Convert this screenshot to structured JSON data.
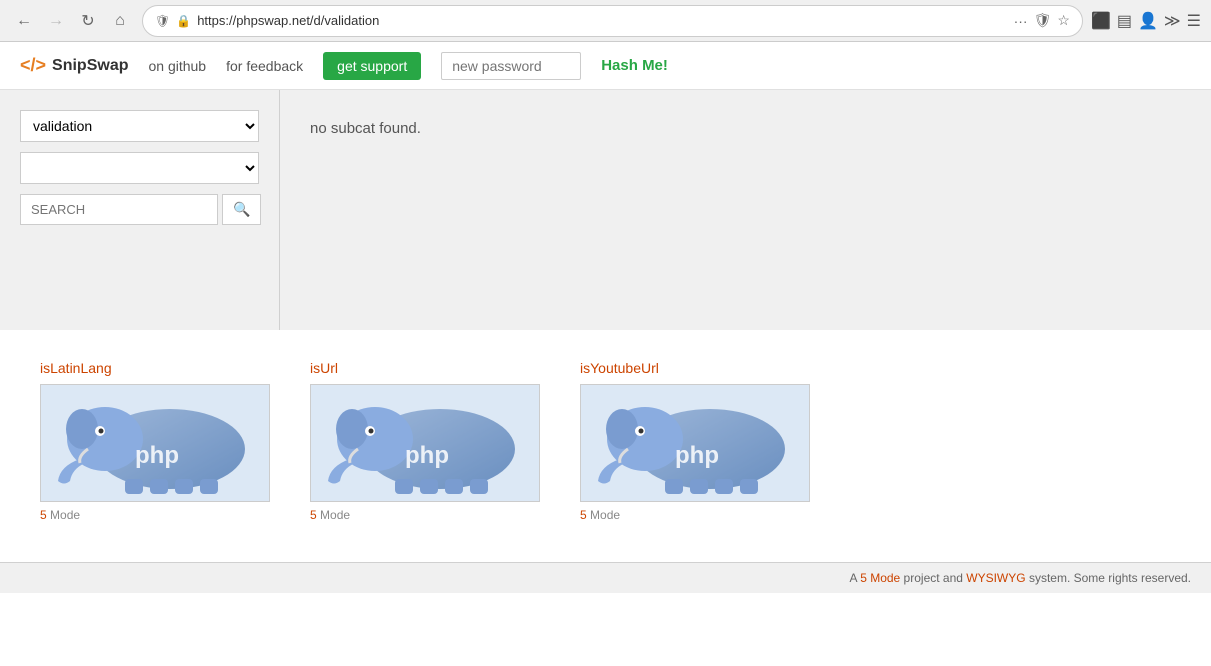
{
  "browser": {
    "url": "https://phpswap.net/d/validation",
    "back_disabled": false,
    "forward_disabled": true
  },
  "header": {
    "logo_text": "SnipSwap",
    "nav_links": [
      {
        "label": "on github",
        "url": "#"
      },
      {
        "label": "for feedback",
        "url": "#"
      }
    ],
    "get_support_label": "get support",
    "password_placeholder": "new password",
    "hash_me_label": "Hash Me!"
  },
  "sidebar": {
    "category_value": "validation",
    "category_options": [
      {
        "value": "validation",
        "label": "validation"
      }
    ],
    "subcat_value": "",
    "subcat_options": [],
    "search_placeholder": "SEARCH"
  },
  "content": {
    "no_subcat_message": "no subcat found."
  },
  "snippets": [
    {
      "title": "isLatinLang",
      "mode": "5 Mode",
      "mode_link": "5"
    },
    {
      "title": "isUrl",
      "mode": "5 Mode",
      "mode_link": "5"
    },
    {
      "title": "isYoutubeUrl",
      "mode": "5 Mode",
      "mode_link": "5"
    }
  ],
  "footer": {
    "text_prefix": "A ",
    "mode_link_text": "5 Mode",
    "text_middle": " project and ",
    "wysiwyg_link_text": "WYSIWYG",
    "text_suffix": " system. Some rights reserved."
  }
}
